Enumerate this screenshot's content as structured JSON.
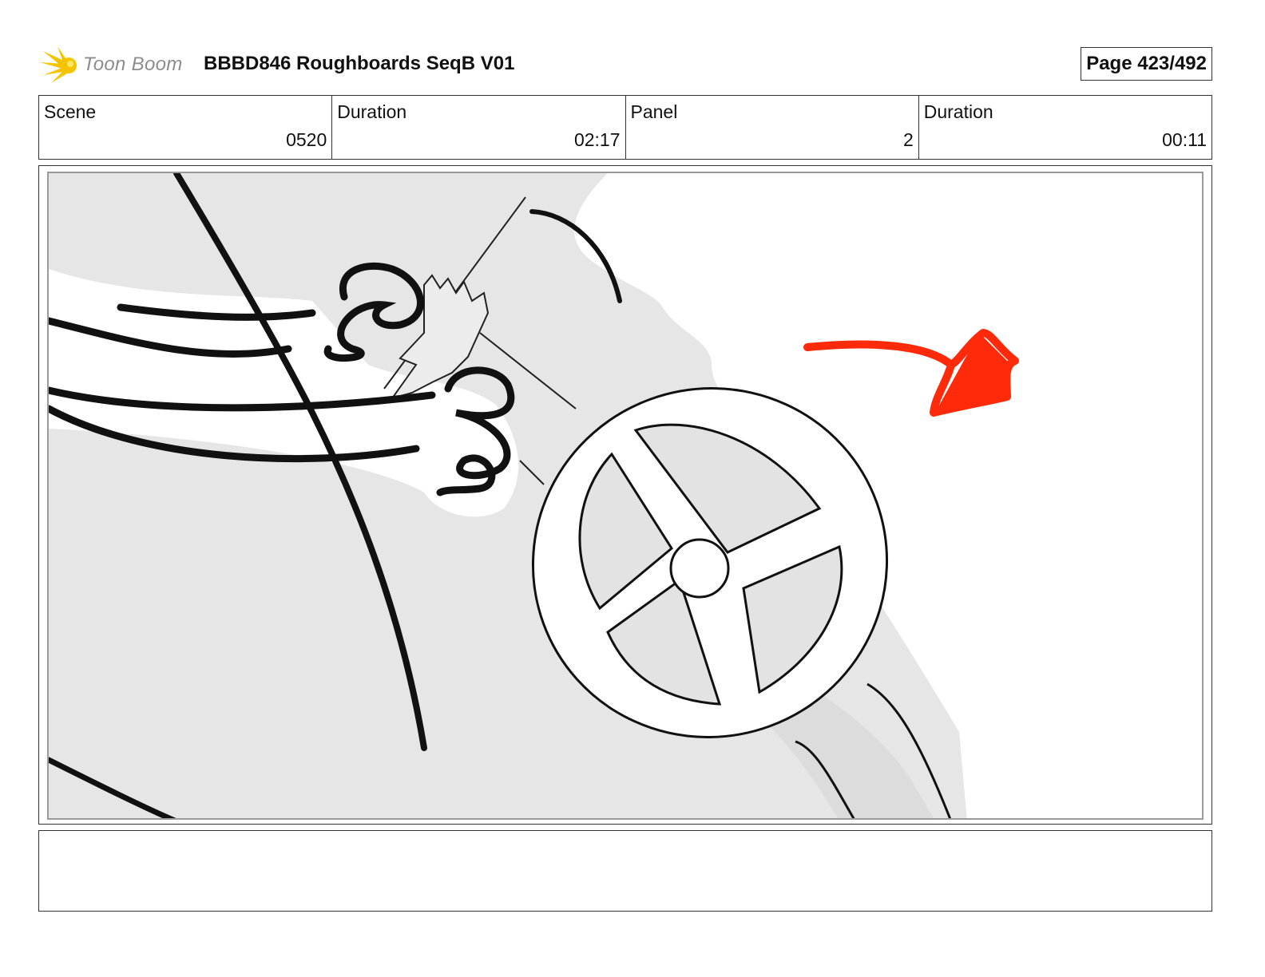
{
  "header": {
    "logo_text": "Toon Boom",
    "title": "BBBD846 Roughboards SeqB V01",
    "page_label": "Page 423/492"
  },
  "info": [
    {
      "label": "Scene",
      "value": "0520"
    },
    {
      "label": "Duration",
      "value": "02:17"
    },
    {
      "label": "Panel",
      "value": "2"
    },
    {
      "label": "Duration",
      "value": "00:11"
    }
  ],
  "panel": {
    "icons": [
      "sketch-hands-gripping-pole",
      "sketch-valve-wheel",
      "red-arrow-icon"
    ],
    "arrow_color": "#ff2a0a",
    "logo_color": "#f5c400"
  },
  "notes": {
    "text": ""
  }
}
